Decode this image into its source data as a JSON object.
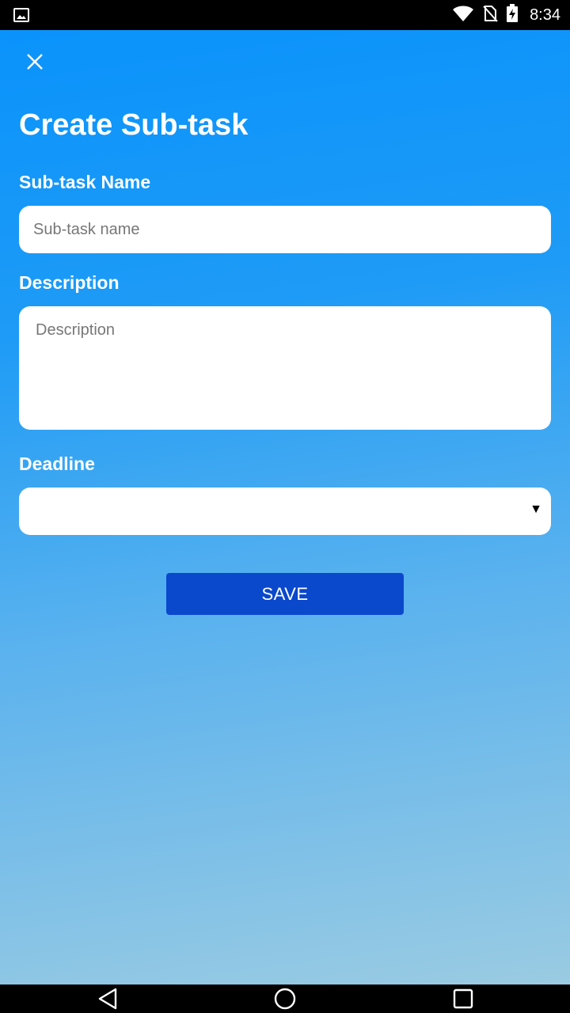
{
  "status_bar": {
    "time": "8:34",
    "icons": [
      "gallery-notification-icon",
      "wifi-icon",
      "no-sim-icon",
      "battery-charging-icon"
    ]
  },
  "header": {
    "close_icon": "close-icon",
    "title": "Create Sub-task"
  },
  "form": {
    "name": {
      "label": "Sub-task Name",
      "placeholder": "Sub-task name",
      "value": ""
    },
    "description": {
      "label": "Description",
      "placeholder": "Description",
      "value": ""
    },
    "deadline": {
      "label": "Deadline",
      "value": "",
      "arrow": "▼"
    },
    "save_label": "SAVE"
  },
  "nav_bar": {
    "icons": [
      "back-icon",
      "home-icon",
      "recents-icon"
    ]
  },
  "colors": {
    "gradient_top": "#0a93fb",
    "gradient_bottom": "#9acbe2",
    "save_button": "#0a48cc",
    "field_background": "#ffffff"
  }
}
